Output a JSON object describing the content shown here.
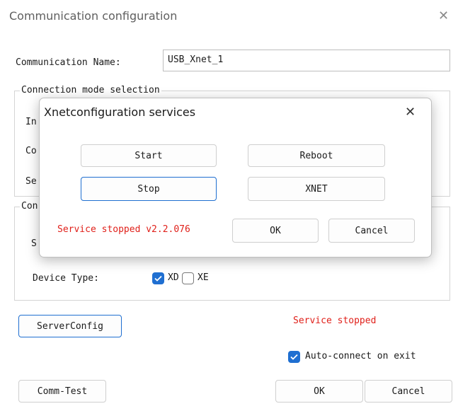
{
  "window": {
    "title": "Communication configuration",
    "close_glyph": "✕"
  },
  "comm_name": {
    "label": "Communication Name:",
    "value": "USB_Xnet_1"
  },
  "connection_mode": {
    "legend": "Connection mode selection",
    "row_labels_partial": [
      "In",
      "Co",
      "Se"
    ]
  },
  "connection_group": {
    "legend_partial": "Con",
    "row_label_partial": "S"
  },
  "device_type": {
    "label": "Device Type:",
    "options": [
      {
        "label": "XD",
        "checked": true
      },
      {
        "label": "XE",
        "checked": false
      }
    ]
  },
  "buttons": {
    "server_config": "ServerConfig",
    "comm_test": "Comm-Test",
    "ok": "OK",
    "cancel": "Cancel"
  },
  "status_text": "Service stopped",
  "auto_connect": {
    "label": "Auto-connect on exit",
    "checked": true
  },
  "dialog": {
    "title": "Xnetconfiguration services",
    "close_glyph": "✕",
    "buttons": {
      "start": "Start",
      "reboot": "Reboot",
      "stop": "Stop",
      "xnet": "XNET",
      "ok": "OK",
      "cancel": "Cancel"
    },
    "status_text": "Service stopped v2.2.076"
  },
  "colors": {
    "accent": "#1f6fd1",
    "status_red": "#e0201a",
    "window_bg": "#ffffff",
    "title_gray": "#5f5f5f"
  }
}
